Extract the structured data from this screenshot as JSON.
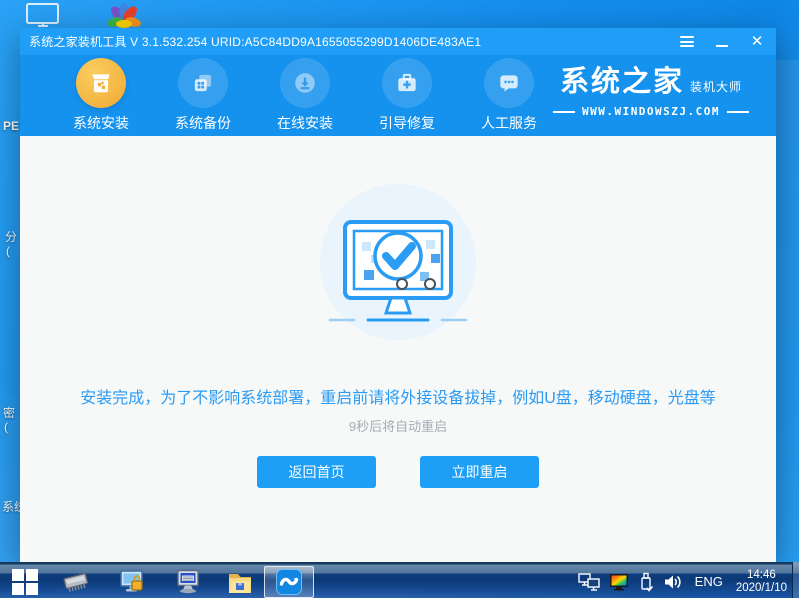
{
  "desktop": {
    "fragments": [
      "PE",
      "分",
      "(",
      "密",
      "(",
      "系统"
    ],
    "icons": [
      "monitor-outline-icon",
      "syshome-flower-logo"
    ]
  },
  "window": {
    "title": "系统之家装机工具 V 3.1.532.254 URID:A5C84DD9A1655055299D1406DE483AE1",
    "controls": {
      "menu": "menu-icon",
      "minimize": "minimize-icon",
      "close": "close-icon"
    },
    "nav": {
      "items": [
        {
          "label": "系统安装",
          "icon": "install-box-icon",
          "active": true
        },
        {
          "label": "系统备份",
          "icon": "backup-copies-icon",
          "active": false
        },
        {
          "label": "在线安装",
          "icon": "online-download-icon",
          "active": false
        },
        {
          "label": "引导修复",
          "icon": "repair-kit-icon",
          "active": false
        },
        {
          "label": "人工服务",
          "icon": "chat-service-icon",
          "active": false
        }
      ],
      "brand": {
        "name": "系统之家",
        "tagline": "装机大师",
        "site": "WWW.WINDOWSZJ.COM"
      }
    },
    "main": {
      "illustration": "monitor-checkmark-illustration",
      "message": "安装完成，为了不影响系统部署，重启前请将外接设备拔掉，例如U盘，移动硬盘，光盘等",
      "countdown": "9秒后将自动重启",
      "buttons": [
        {
          "label": "返回首页"
        },
        {
          "label": "立即重启"
        }
      ]
    }
  },
  "taskbar": {
    "apps": [
      "start-button",
      "memory-chip-app",
      "display-lock-app",
      "keyboard-monitor-app",
      "file-explorer-app",
      "syshome-installer-app-active"
    ],
    "tray": {
      "lang": "ENG",
      "time": "14:46",
      "date": "2020/1/10"
    }
  },
  "colors": {
    "titlebar": "#209ef7",
    "navbar": "#1591ee",
    "accent_orange": "#f2ab35",
    "message_blue": "#2b9bf4",
    "button_blue": "#1e9ff5",
    "content_bg": "#f7f8f8"
  }
}
